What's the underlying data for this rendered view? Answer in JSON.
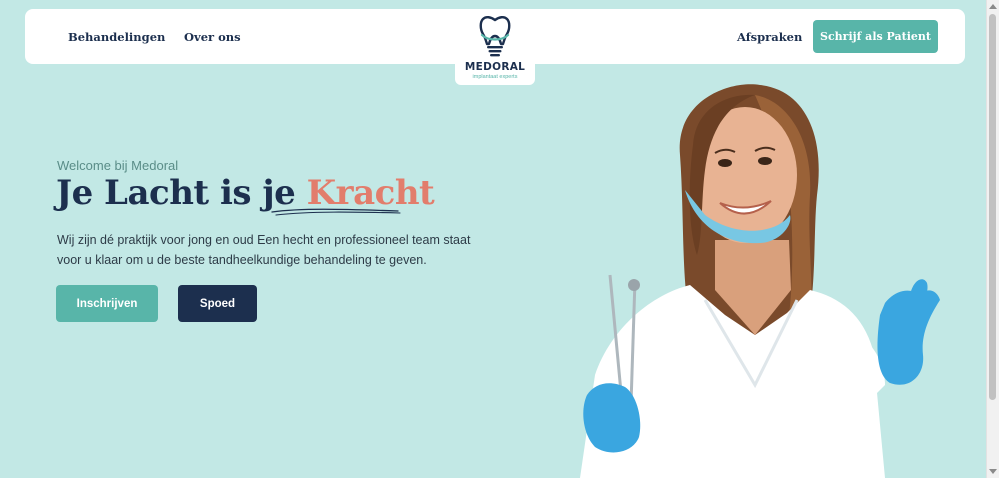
{
  "nav": {
    "left_links": [
      "Behandelingen",
      "Over ons"
    ],
    "right_link": "Afspraken",
    "cta_label": "Schrijf als Patient"
  },
  "logo": {
    "name": "MEDORAL",
    "tagline": "implantaat experts",
    "icon": "tooth-implant-icon"
  },
  "hero": {
    "welcome": "Welcome bij Medoral",
    "headline_main": "Je Lacht is je ",
    "headline_accent": "Kracht",
    "description": "Wij zijn dé praktijk voor jong en oud Een hecht en professioneel team staat voor u klaar om u de beste tandheelkundige behandeling te geven.",
    "primary_button": "Inschrijven",
    "secondary_button": "Spoed",
    "image": "smiling-dentist-photo"
  },
  "colors": {
    "background": "#c2e8e5",
    "navy": "#1c2f4e",
    "teal": "#58b5a9",
    "coral": "#e27d6c"
  }
}
